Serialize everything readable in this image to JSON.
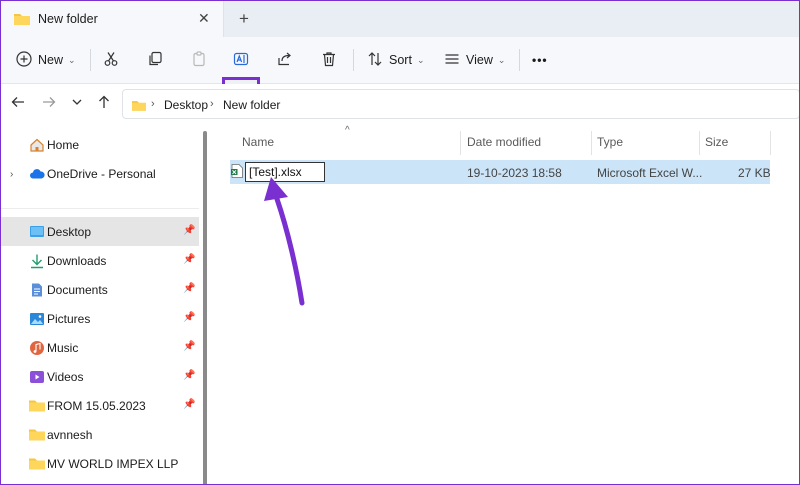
{
  "window": {
    "tab_title": "New folder",
    "tab_close": "✕",
    "new_tab": "+"
  },
  "toolbar": {
    "new_label": "New",
    "sort_label": "Sort",
    "view_label": "View",
    "more_label": "•••",
    "icons": [
      "plus-circle-icon",
      "cut-icon",
      "copy-icon",
      "paste-icon",
      "rename-icon",
      "share-icon",
      "delete-icon",
      "sort-icon",
      "view-icon"
    ]
  },
  "address": {
    "crumbs": [
      "Desktop",
      "New folder"
    ]
  },
  "nav": {
    "items": [
      {
        "label": "Home",
        "icon": "home-icon",
        "pinned": false
      },
      {
        "label": "OneDrive - Personal",
        "icon": "cloud-icon",
        "pinned": false,
        "expandable": true
      },
      {
        "label": "Desktop",
        "icon": "desktop-icon",
        "pinned": true,
        "selected": true
      },
      {
        "label": "Downloads",
        "icon": "download-icon",
        "pinned": true
      },
      {
        "label": "Documents",
        "icon": "documents-icon",
        "pinned": true
      },
      {
        "label": "Pictures",
        "icon": "pictures-icon",
        "pinned": true
      },
      {
        "label": "Music",
        "icon": "music-icon",
        "pinned": true
      },
      {
        "label": "Videos",
        "icon": "videos-icon",
        "pinned": true
      },
      {
        "label": "FROM 15.05.2023",
        "icon": "folder-icon",
        "pinned": true
      },
      {
        "label": "avnnesh",
        "icon": "folder-icon",
        "pinned": false
      },
      {
        "label": "MV WORLD IMPEX LLP",
        "icon": "folder-icon",
        "pinned": false
      }
    ]
  },
  "list": {
    "columns": [
      "Name",
      "Date modified",
      "Type",
      "Size"
    ],
    "rows": [
      {
        "name": "[Test].xlsx",
        "date": "19-10-2023 18:58",
        "type": "Microsoft Excel W...",
        "size": "27 KB"
      }
    ]
  },
  "colors": {
    "accent": "#7a2fd0",
    "selection": "#cce4f7",
    "nav_selected": "#e5e5e5"
  }
}
